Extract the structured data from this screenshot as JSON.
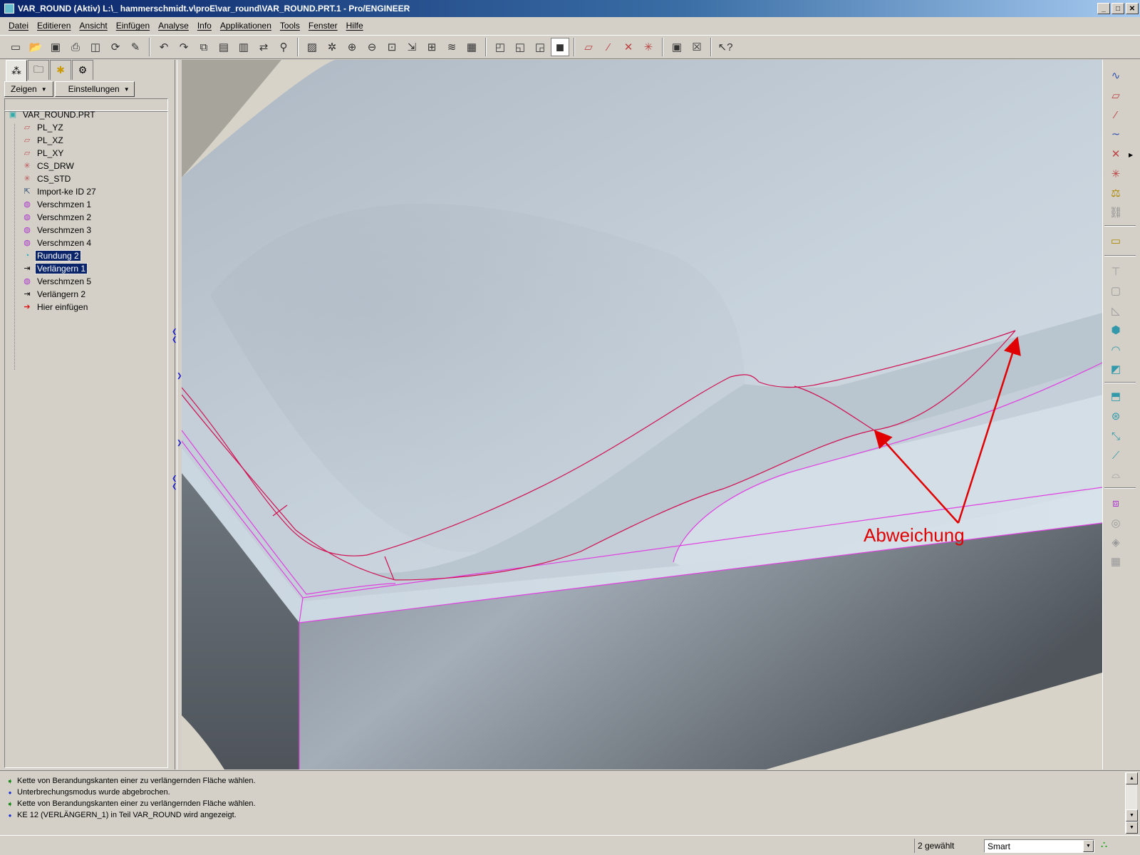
{
  "window": {
    "title": "VAR_ROUND (Aktiv) L:\\_ hammerschmidt.v\\proE\\var_round\\VAR_ROUND.PRT.1 - Pro/ENGINEER",
    "minimize": "_",
    "maximize": "□",
    "close": "✕"
  },
  "menu": [
    "Datei",
    "Editieren",
    "Ansicht",
    "Einfügen",
    "Analyse",
    "Info",
    "Applikationen",
    "Tools",
    "Fenster",
    "Hilfe"
  ],
  "toolbar": {
    "groups": [
      [
        "new-icon",
        "open-icon",
        "save-icon",
        "print-icon",
        "preview-icon",
        "regenerate-icon",
        "edit-icon"
      ],
      [
        "undo-icon",
        "redo-icon",
        "copy-icon",
        "paste-icon",
        "paste-special-icon",
        "mirror-icon",
        "find-icon"
      ],
      [
        "repaint-icon",
        "spin-center-icon",
        "zoom-in-icon",
        "zoom-out-icon",
        "refit-icon",
        "orient-icon",
        "saved-views-icon",
        "layers-icon",
        "view-manager-icon"
      ],
      [
        "wireframe-icon",
        "hidden-line-icon",
        "no-hidden-icon",
        "shading-icon"
      ],
      [
        "datum-planes-icon",
        "datum-axes-icon",
        "datum-points-icon",
        "coord-systems-icon"
      ],
      [
        "close-window-icon",
        "erase-window-icon"
      ],
      [
        "context-help-icon"
      ]
    ],
    "active": "shading-icon"
  },
  "panel": {
    "tabs": [
      "model-tree-icon",
      "folder-browser-icon",
      "favorites-icon",
      "connections-icon"
    ],
    "show_button": "Zeigen",
    "settings_button": "Einstellungen",
    "root": "VAR_ROUND.PRT",
    "items": [
      {
        "label": "PL_YZ",
        "icon": "datum-plane-icon",
        "selected": false
      },
      {
        "label": "PL_XZ",
        "icon": "datum-plane-icon",
        "selected": false
      },
      {
        "label": "PL_XY",
        "icon": "datum-plane-icon",
        "selected": false
      },
      {
        "label": "CS_DRW",
        "icon": "coord-system-icon",
        "selected": false
      },
      {
        "label": "CS_STD",
        "icon": "coord-system-icon",
        "selected": false
      },
      {
        "label": "Import-ke ID 27",
        "icon": "import-feature-icon",
        "selected": false
      },
      {
        "label": "Verschmzen 1",
        "icon": "merge-icon",
        "selected": false
      },
      {
        "label": "Verschmzen 2",
        "icon": "merge-icon",
        "selected": false
      },
      {
        "label": "Verschmzen 3",
        "icon": "merge-icon",
        "selected": false
      },
      {
        "label": "Verschmzen 4",
        "icon": "merge-icon",
        "selected": false
      },
      {
        "label": "Rundung 2",
        "icon": "round-icon",
        "selected": true
      },
      {
        "label": "Verlängern 1",
        "icon": "extend-icon",
        "selected": true
      },
      {
        "label": "Verschmzen 5",
        "icon": "merge-icon",
        "selected": false
      },
      {
        "label": "Verlängern 2",
        "icon": "extend-icon",
        "selected": false
      },
      {
        "label": "Hier einfügen",
        "icon": "insert-here-icon",
        "selected": false
      }
    ]
  },
  "viewport": {
    "annotation": "Abweichung",
    "annotation_color": "#e00000",
    "edge_color": "#d01050",
    "boundary_color": "#e040e0"
  },
  "right_toolbar": [
    "sketched-curve-icon",
    "datum-plane-tool-icon",
    "datum-axis-tool-icon",
    "datum-curve-tool-icon",
    "datum-point-tool-icon",
    "coord-system-tool-icon",
    "analysis-feature-icon",
    "chain-icon",
    "annotation-icon",
    "hole-icon",
    "shell-icon",
    "rib-icon",
    "draft-icon",
    "round-tool-icon",
    "chamfer-icon",
    "extrude-icon",
    "revolve-icon",
    "variable-sweep-icon",
    "blend-icon",
    "boundary-blend-icon",
    "mirror-tool-icon",
    "merge-tool-icon",
    "trim-icon",
    "pattern-icon"
  ],
  "messages": [
    {
      "type": "prompt",
      "text": "Kette von Berandungskanten einer zu verlängernden Fläche wählen."
    },
    {
      "type": "info",
      "text": "Unterbrechungsmodus wurde abgebrochen."
    },
    {
      "type": "prompt",
      "text": "Kette von Berandungskanten einer zu verlängernden Fläche wählen."
    },
    {
      "type": "info",
      "text": "KE 12 (VERLÄNGERN_1) in Teil VAR_ROUND wird angezeigt."
    }
  ],
  "status": {
    "selected": "2 gewählt",
    "filter": "Smart"
  }
}
